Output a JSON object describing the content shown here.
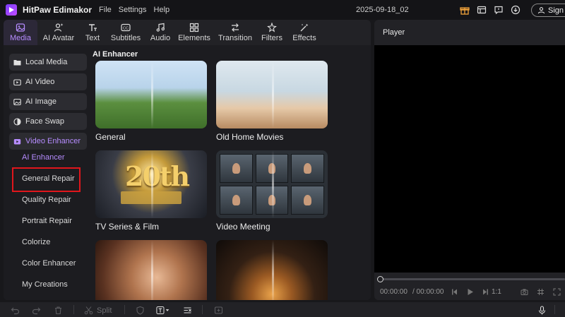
{
  "app": {
    "name": "HitPaw Edimakor",
    "project": "2025-09-18_02",
    "accent": "#b68cff"
  },
  "menu": [
    "File",
    "Settings",
    "Help"
  ],
  "signin": {
    "label": "Sign in"
  },
  "toolbar": [
    {
      "label": "Media",
      "icon": "media-icon"
    },
    {
      "label": "AI Avatar",
      "icon": "ai-avatar-icon"
    },
    {
      "label": "Text",
      "icon": "text-icon"
    },
    {
      "label": "Subtitles",
      "icon": "subtitles-icon"
    },
    {
      "label": "Audio",
      "icon": "audio-icon"
    },
    {
      "label": "Elements",
      "icon": "elements-icon"
    },
    {
      "label": "Transition",
      "icon": "transition-icon"
    },
    {
      "label": "Filters",
      "icon": "filters-icon"
    },
    {
      "label": "Effects",
      "icon": "effects-icon"
    }
  ],
  "sidebar": {
    "items": [
      {
        "label": "Local Media",
        "icon": "folder-icon"
      },
      {
        "label": "AI Video",
        "icon": "ai-video-icon"
      },
      {
        "label": "AI Image",
        "icon": "ai-image-icon"
      },
      {
        "label": "Face Swap",
        "icon": "face-swap-icon"
      },
      {
        "label": "Video Enhancer",
        "icon": "video-enhancer-icon"
      }
    ],
    "subitems": [
      "AI Enhancer",
      "General Repair",
      "Quality Repair",
      "Portrait Repair",
      "Colorize",
      "Color Enhancer",
      "My Creations"
    ]
  },
  "main": {
    "section_title": "AI Enhancer",
    "cards": [
      {
        "label": "General"
      },
      {
        "label": "Old Home Movies"
      },
      {
        "label": "TV Series & Film"
      },
      {
        "label": "Video Meeting"
      },
      {
        "label": ""
      },
      {
        "label": ""
      }
    ],
    "tv_thumb_text": "20th"
  },
  "player": {
    "title": "Player",
    "time_current": "00:00:00",
    "time_total": "/ 00:00:00",
    "speed": "1:1"
  },
  "bottom": {
    "split_label": "Split"
  }
}
